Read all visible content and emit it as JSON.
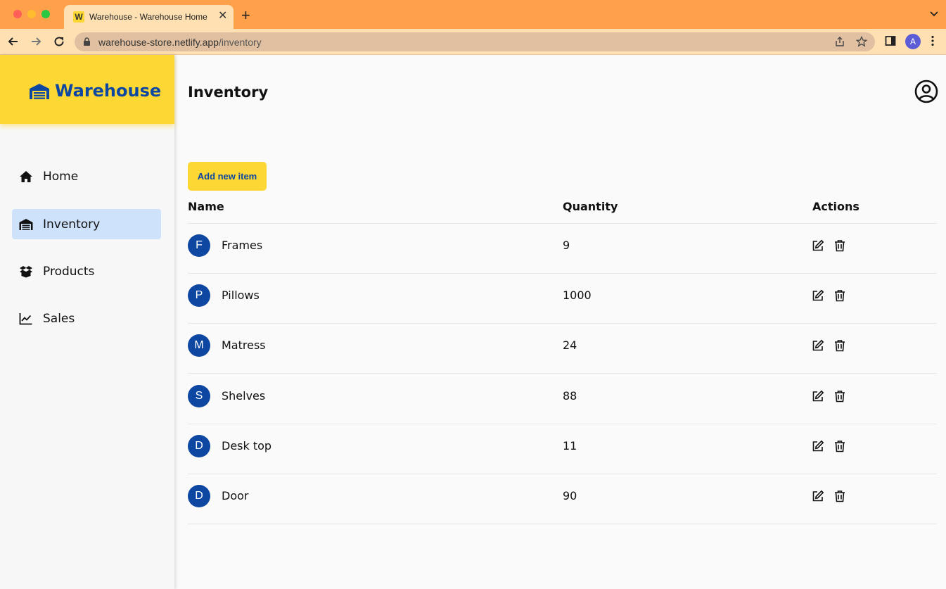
{
  "browser": {
    "tab_favicon": "W",
    "tab_title": "Warehouse - Warehouse Home",
    "url_host": "warehouse-store.netlify.app",
    "url_path": "/inventory",
    "profile_initial": "A"
  },
  "sidebar": {
    "brand": "Warehouse",
    "items": [
      {
        "label": "Home",
        "icon": "home-icon",
        "active": false
      },
      {
        "label": "Inventory",
        "icon": "warehouse-icon",
        "active": true
      },
      {
        "label": "Products",
        "icon": "box-icon",
        "active": false
      },
      {
        "label": "Sales",
        "icon": "chart-line-icon",
        "active": false
      }
    ]
  },
  "main": {
    "title": "Inventory",
    "add_button": "Add new item",
    "columns": {
      "name": "Name",
      "quantity": "Quantity",
      "actions": "Actions"
    },
    "rows": [
      {
        "initial": "F",
        "name": "Frames",
        "quantity": "9"
      },
      {
        "initial": "P",
        "name": "Pillows",
        "quantity": "1000"
      },
      {
        "initial": "M",
        "name": "Matress",
        "quantity": "24"
      },
      {
        "initial": "S",
        "name": "Shelves",
        "quantity": "88"
      },
      {
        "initial": "D",
        "name": "Desk top",
        "quantity": "11"
      },
      {
        "initial": "D",
        "name": "Door",
        "quantity": "90"
      }
    ]
  },
  "colors": {
    "brand_yellow": "#fdd835",
    "brand_blue": "#0d47a1",
    "active_nav": "#cfe2fc",
    "browser_orange": "#ffa14a"
  }
}
